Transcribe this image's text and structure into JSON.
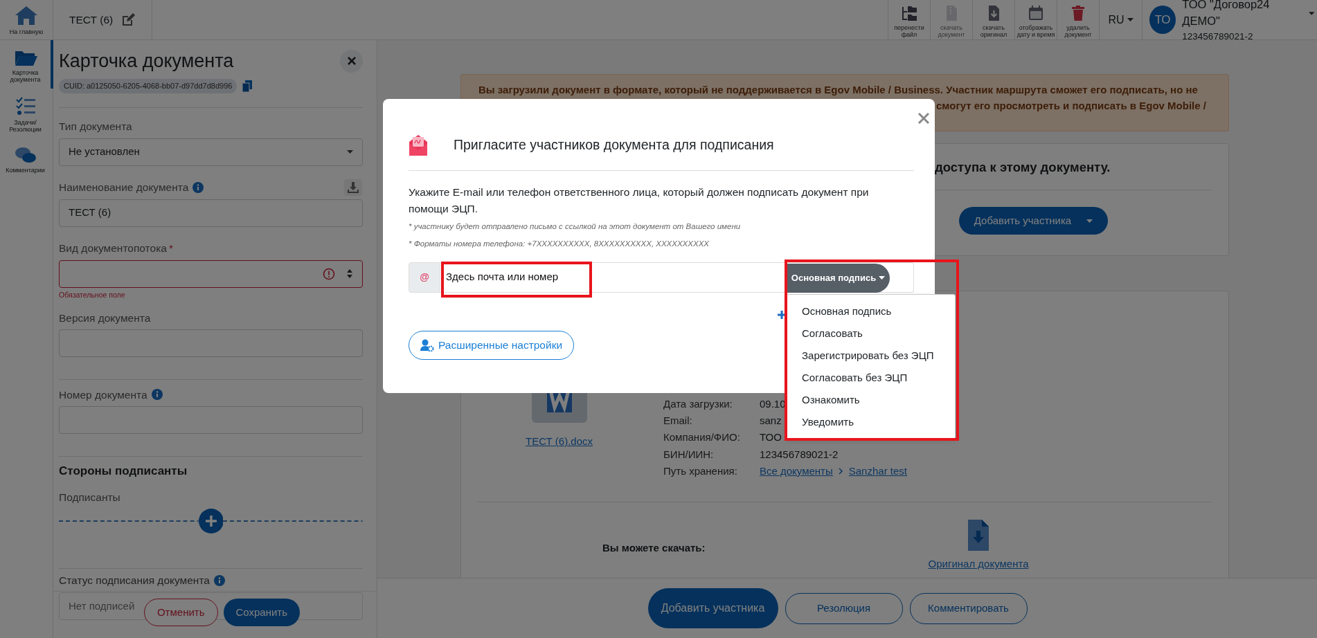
{
  "rail": [
    {
      "label": "На главную",
      "kind": "home",
      "selected": false
    },
    {
      "label": "Карточка документа",
      "kind": "folder",
      "selected": true
    },
    {
      "label": "Задачи/ Резолюции",
      "kind": "tasks",
      "selected": false
    },
    {
      "label": "Комментарии",
      "kind": "comments",
      "selected": false
    }
  ],
  "header": {
    "title": "ТЕСТ (6)",
    "toolbar": [
      {
        "label": "перенести файл",
        "kind": "move",
        "disabled": false
      },
      {
        "label": "скачать документ",
        "kind": "zip",
        "disabled": true
      },
      {
        "label": "скачать оригинал",
        "kind": "download",
        "disabled": false
      },
      {
        "label": "отображать дату и время",
        "kind": "calendar",
        "disabled": false
      },
      {
        "label": "удалить документ",
        "kind": "trash",
        "disabled": false
      }
    ],
    "language": "RU",
    "account": {
      "initials": "ТО",
      "name": "ТОО \"Договор24 ДЕМО\"",
      "id": "123456789021-2"
    }
  },
  "card": {
    "title": "Карточка документа",
    "cuid": "CUID: a0125050-6205-4068-bb07-d97dd7d8d996",
    "fields": [
      {
        "label": "Тип документа",
        "kind": "dropdown",
        "value": "Не установлен",
        "info": false,
        "invalid": false,
        "separated": false
      },
      {
        "label": "Наименование документа",
        "kind": "input",
        "value": "ТЕСТ (6)",
        "info": true,
        "download": true,
        "invalid": false,
        "separated": false
      },
      {
        "label": "Вид документопотока",
        "required_mark": "*",
        "kind": "select",
        "info": false,
        "invalid": true,
        "error": "Обязательное поле",
        "separated": false
      },
      {
        "label": "Версия документа",
        "kind": "input",
        "info": false,
        "invalid": false,
        "separated": true
      },
      {
        "label": "Номер документа",
        "kind": "input",
        "info": true,
        "invalid": false,
        "separated": true
      }
    ],
    "section": "Стороны подписанты",
    "signers_label": "Подписанты",
    "status_label": "Статус подписания документа",
    "status_value": "Нет подписей",
    "buttons": [
      {
        "label": "Отменить",
        "kind": "cancel"
      },
      {
        "label": "Сохранить",
        "kind": "save"
      }
    ]
  },
  "main": {
    "warning": [
      "Вы загрузили документ в формате, который не поддерживается в Egov Mobile / Business. Участник маршрута сможет его подписать, но не",
      "смогут его просмотреть и подписать в Egov Mobile /"
    ],
    "access_heading": "доступа к этому документу.",
    "add_participant": "Добавить участника",
    "file": {
      "name": "ТЕСТ (6).docx",
      "details": [
        {
          "label": "Дата загрузки:",
          "value": "09.10"
        },
        {
          "label": "Email:",
          "value": "sanz"
        },
        {
          "label": "Компания/ФИО:",
          "value": "ТОО"
        },
        {
          "label": "БИН/ИИН:",
          "value": "123456789021-2"
        },
        {
          "label": "Путь хранения:",
          "path": [
            "Все документы",
            "Sanzhar test"
          ]
        }
      ]
    },
    "download_label": "Вы можете скачать:",
    "download_link": "Оригинал документа",
    "bottom_buttons": [
      {
        "label": "Добавить участника",
        "primary": true
      },
      {
        "label": "Резолюция",
        "primary": false
      },
      {
        "label": "Комментировать",
        "primary": false
      }
    ]
  },
  "modal": {
    "title": "Пригласите участников документа для подписания",
    "text": "Укажите E-mail или телефон ответственного лица, который должен подписать документ при помощи ЭЦП.",
    "notes": [
      "* участнику будет отправлено письмо с ссылкой на этот документ от Вашего имени",
      "* Форматы номера телефона: +7XXXXXXXXXX, 8XXXXXXXXXX, XXXXXXXXXX"
    ],
    "addon": "@",
    "input": {
      "value": "Здесь почта или номер",
      "highlighted": true
    },
    "role": {
      "label": "Основная подпись",
      "highlighted": true,
      "expanded": true,
      "options": [
        "Основная подпись",
        "Согласовать",
        "Зарегистрировать без ЭЦП",
        "Согласовать без ЭЦП",
        "Ознакомить",
        "Уведомить"
      ]
    },
    "advanced": "Расширенные настройки"
  }
}
